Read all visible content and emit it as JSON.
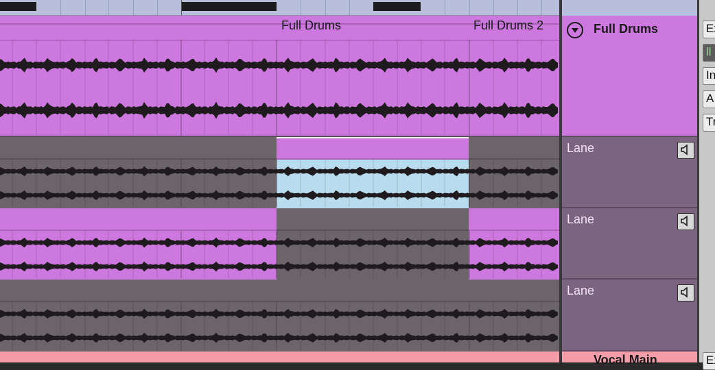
{
  "track": {
    "name": "Full Drums",
    "color": "#cd78de"
  },
  "clips": [
    {
      "label": "Full Drums"
    },
    {
      "label": "Full Drums 2"
    }
  ],
  "lanes": [
    {
      "name": "Lane"
    },
    {
      "name": "Lane"
    },
    {
      "name": "Lane"
    }
  ],
  "next_track": {
    "name": "Vocal Main",
    "color": "#f49ca8"
  },
  "right_strip": {
    "buttons": [
      "Ex",
      "ll",
      "In",
      "A",
      "Tr",
      "Ex"
    ]
  },
  "colors": {
    "lane_bg": "#7a6480",
    "inactive": "#6b6468",
    "selected": "#b9dbee",
    "ruler": "#b7bfdc"
  },
  "icons": {
    "fold": "fold-toggle-icon",
    "speaker": "speaker-icon"
  }
}
